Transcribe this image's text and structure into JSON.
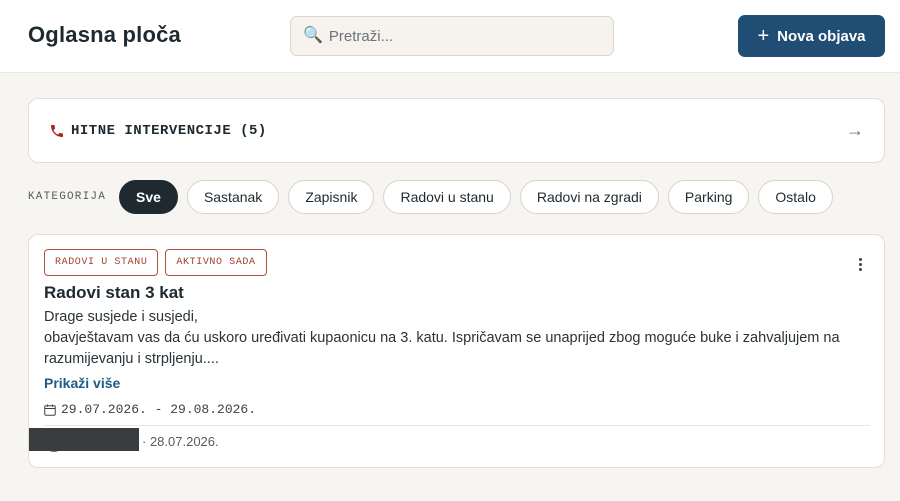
{
  "header": {
    "title": "Oglasna ploča",
    "search_placeholder": "Pretraži...",
    "search_icon": "search-icon",
    "new_post_label": "Nova objava",
    "new_post_icon": "plus-icon"
  },
  "emergency": {
    "icon": "phone-icon",
    "label": "HITNE INTERVENCIJE (5)",
    "arrow": "→"
  },
  "filters": {
    "label": "KATEGORIJA",
    "chips": [
      {
        "label": "Sve",
        "active": true
      },
      {
        "label": "Sastanak",
        "active": false
      },
      {
        "label": "Zapisnik",
        "active": false
      },
      {
        "label": "Radovi u stanu",
        "active": false
      },
      {
        "label": "Radovi na zgradi",
        "active": false
      },
      {
        "label": "Parking",
        "active": false
      },
      {
        "label": "Ostalo",
        "active": false
      }
    ]
  },
  "post": {
    "badges": [
      "RADOVI U STANU",
      "AKTIVNO SADA"
    ],
    "title": "Radovi stan 3 kat",
    "body_line1": "Drage susjede i susjedi,",
    "body_line2": "obavještavam vas da ću uskoro uređivati kupaonicu na 3. katu. Ispričavam se unaprijed zbog moguće buke i zahvaljujem na razumijevanju i strpljenju....",
    "show_more": "Prikaži više",
    "date_range": "29.07.2026. - 29.08.2026.",
    "posted_date": "· 28.07.2026."
  },
  "colors": {
    "primary": "#1f4d73",
    "accent": "#b4533c",
    "dark": "#1f2a30",
    "background": "#f7f5f1"
  }
}
